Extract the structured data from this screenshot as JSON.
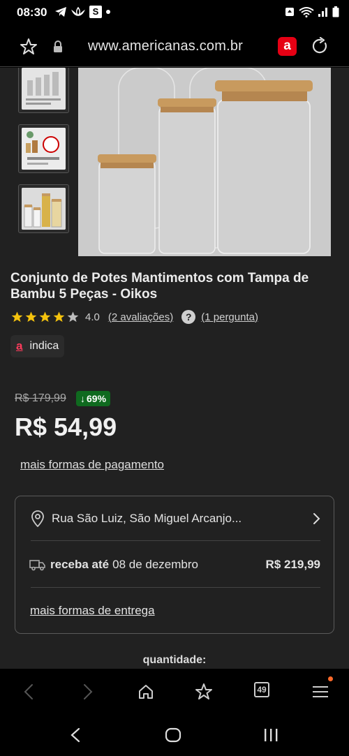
{
  "status_bar": {
    "time": "08:30",
    "s_badge": "S"
  },
  "browser": {
    "url": "www.americanas.com.br",
    "brand_badge": "a"
  },
  "product": {
    "title": "Conjunto de Potes Mantimentos com Tampa de Bambu 5 Peças - Oikos",
    "rating": 4.0,
    "rating_label": "4.0",
    "reviews_link": "(2 avaliações)",
    "questions_link": "(1 pergunta)",
    "help_icon_text": "?",
    "indica_logo": "a",
    "indica_label": "indica",
    "old_price": "R$ 179,99",
    "discount": "69%",
    "discount_arrow": "↓",
    "price": "R$ 54,99",
    "payment_link": "mais formas de pagamento"
  },
  "delivery": {
    "address": "Rua São Luiz, São Miguel Arcanjo...",
    "receive_label": "receba até",
    "receive_date": "08 de dezembro",
    "shipping_price": "R$ 219,99",
    "more_link": "mais formas de entrega"
  },
  "quantity_label": "quantidade:",
  "toolbar": {
    "tab_count": "49"
  },
  "colors": {
    "brand_red": "#e60014",
    "discount_green": "#0f6a1f",
    "star_yellow": "#f4c20d",
    "background": "#212121"
  },
  "icons": [
    "star-outline-icon",
    "lock-icon",
    "reload-icon",
    "map-pin-icon",
    "chevron-right-icon",
    "truck-icon",
    "back-icon",
    "forward-icon",
    "home-icon",
    "bookmark-star-icon",
    "tabs-icon",
    "menu-icon"
  ]
}
